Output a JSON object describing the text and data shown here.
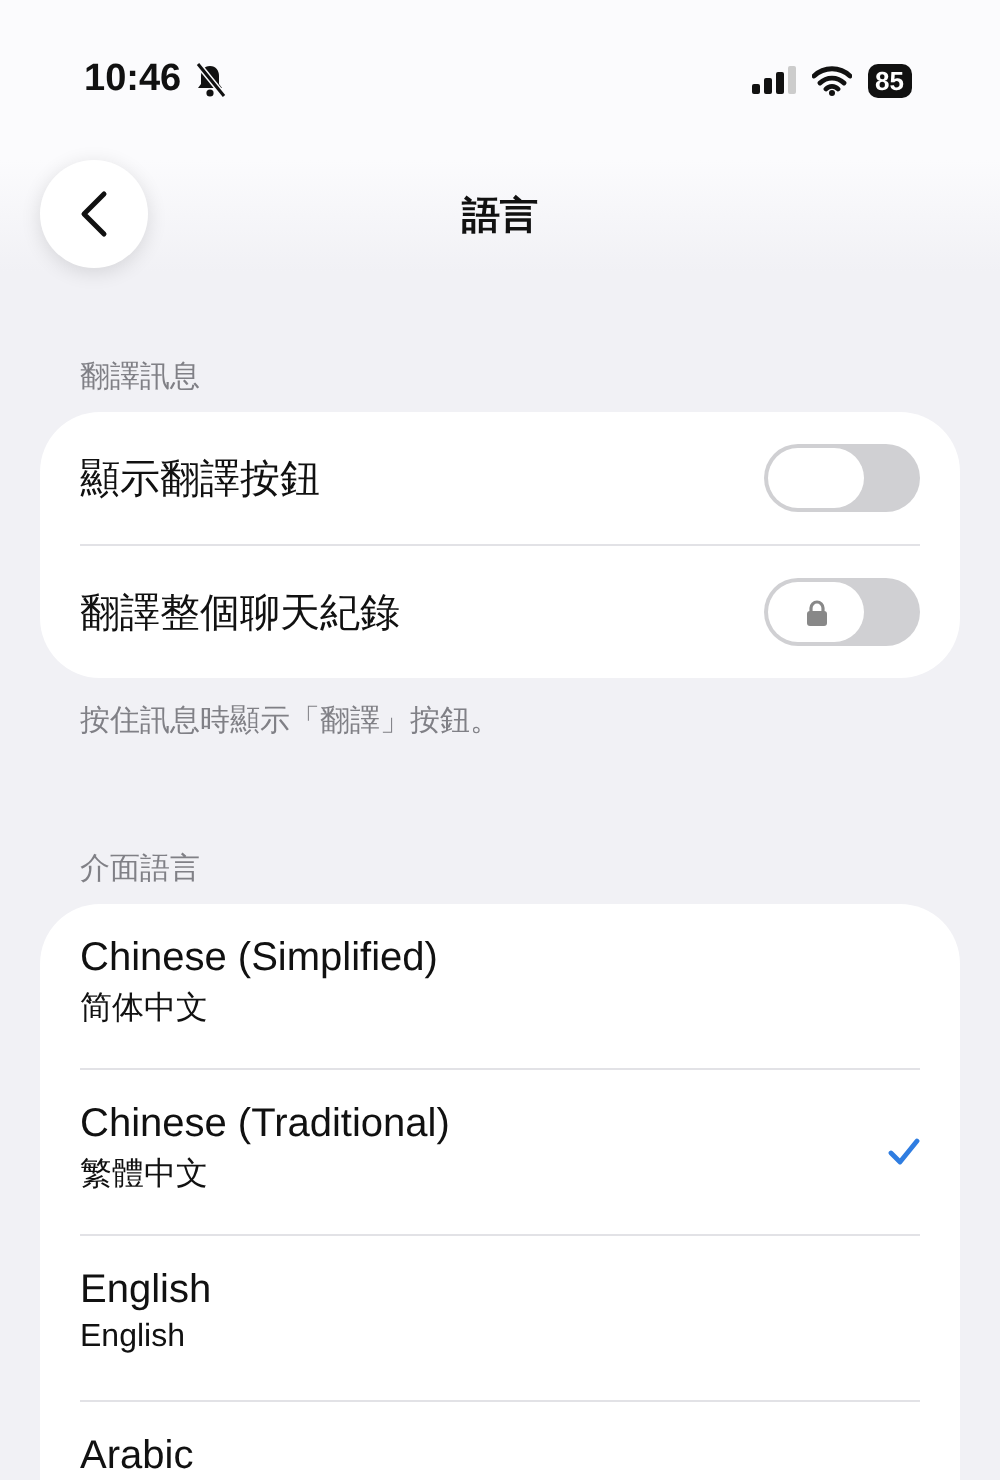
{
  "status_bar": {
    "time": "10:46",
    "silent": true,
    "battery": "85"
  },
  "header": {
    "title": "語言"
  },
  "translation_section": {
    "title": "翻譯訊息",
    "rows": [
      {
        "label": "顯示翻譯按鈕",
        "on": false,
        "locked": false
      },
      {
        "label": "翻譯整個聊天紀錄",
        "on": false,
        "locked": true
      }
    ],
    "footer": "按住訊息時顯示「翻譯」按鈕。"
  },
  "language_section": {
    "title": "介面語言",
    "items": [
      {
        "name": "Chinese (Simplified)",
        "native": "简体中文",
        "selected": false
      },
      {
        "name": "Chinese (Traditional)",
        "native": "繁體中文",
        "selected": true
      },
      {
        "name": "English",
        "native": "English",
        "selected": false
      },
      {
        "name": "Arabic",
        "selected": false
      }
    ]
  }
}
